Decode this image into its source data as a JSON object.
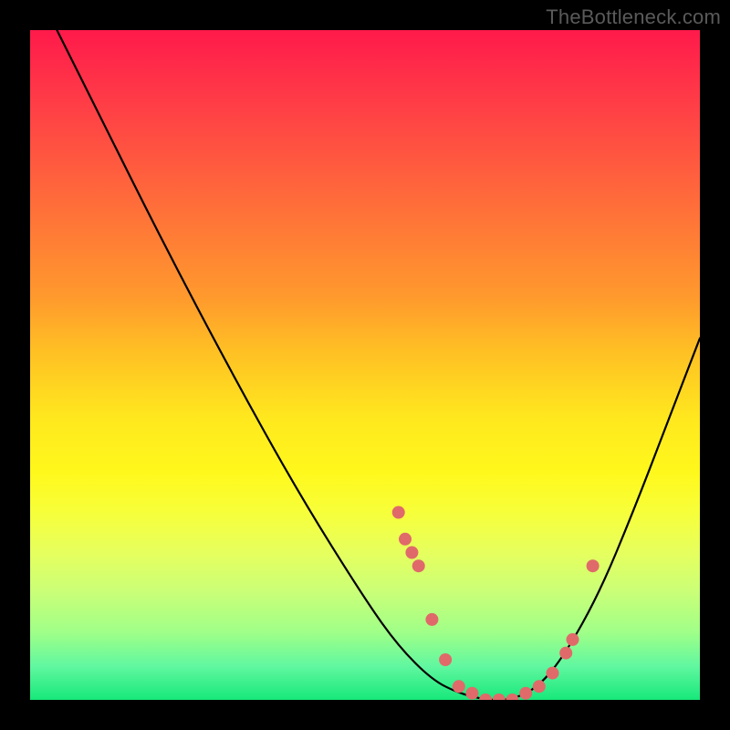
{
  "watermark": "TheBottleneck.com",
  "chart_data": {
    "type": "line",
    "title": "",
    "xlabel": "",
    "ylabel": "",
    "xlim": [
      0,
      100
    ],
    "ylim": [
      0,
      100
    ],
    "series": [
      {
        "name": "curve",
        "x": [
          4,
          10,
          20,
          30,
          40,
          50,
          55,
          60,
          64,
          68,
          72,
          76,
          80,
          85,
          90,
          95,
          100
        ],
        "values": [
          100,
          88,
          68,
          49,
          31,
          15,
          8,
          3,
          1,
          0,
          0,
          2,
          7,
          16,
          28,
          41,
          54
        ]
      }
    ],
    "markers": {
      "name": "highlight-points",
      "color": "#e06a6a",
      "x": [
        55,
        56,
        57,
        58,
        60,
        62,
        64,
        66,
        68,
        70,
        72,
        74,
        76,
        78,
        80,
        81,
        84
      ],
      "values": [
        28,
        24,
        22,
        20,
        12,
        6,
        2,
        1,
        0,
        0,
        0,
        1,
        2,
        4,
        7,
        9,
        20
      ]
    }
  }
}
